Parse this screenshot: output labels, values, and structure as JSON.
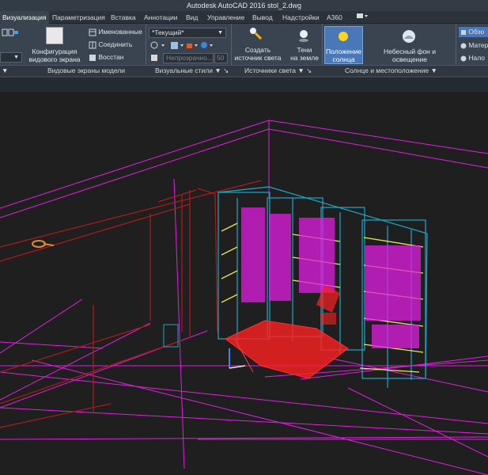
{
  "window": {
    "title": "Autodesk AutoCAD 2016   stol_2.dwg"
  },
  "tabs": [
    {
      "label": "Визуализация",
      "active": true
    },
    {
      "label": "Параметризация"
    },
    {
      "label": "Вставка"
    },
    {
      "label": "Аннотации"
    },
    {
      "label": "Вид"
    },
    {
      "label": "Управление"
    },
    {
      "label": "Вывод"
    },
    {
      "label": "Надстройки"
    },
    {
      "label": "A360"
    }
  ],
  "viewports_panel": {
    "config_label_1": "Конфигурация",
    "config_label_2": "видового экрана",
    "named": "Именованные",
    "join": "Соединить",
    "restore": "Восстан",
    "title": "Видовые экраны модели"
  },
  "visual_styles_panel": {
    "current_style": "*Текущий*",
    "opacity_label": "Непрозрачно...",
    "opacity_value": "50",
    "title": "Визуальные стили"
  },
  "lights_panel": {
    "create_light_1": "Создать",
    "create_light_2": "источник света",
    "ground_shadows_1": "Тени",
    "ground_shadows_2": "на земле",
    "title": "Источники света"
  },
  "sun_panel": {
    "sun_status_1": "Положение",
    "sun_status_2": "солнца",
    "sky_label": "Небесный фон и освещение",
    "title": "Солнце и местоположение"
  },
  "render_panel": {
    "item1": "Обзо",
    "item2": "Матер",
    "item3": "Нало"
  },
  "colors": {
    "magenta": "#e21ee2",
    "red": "#ff2020",
    "cyan": "#1aa8c8",
    "yellow": "#e8e850",
    "dark_red": "#b01a1a"
  }
}
